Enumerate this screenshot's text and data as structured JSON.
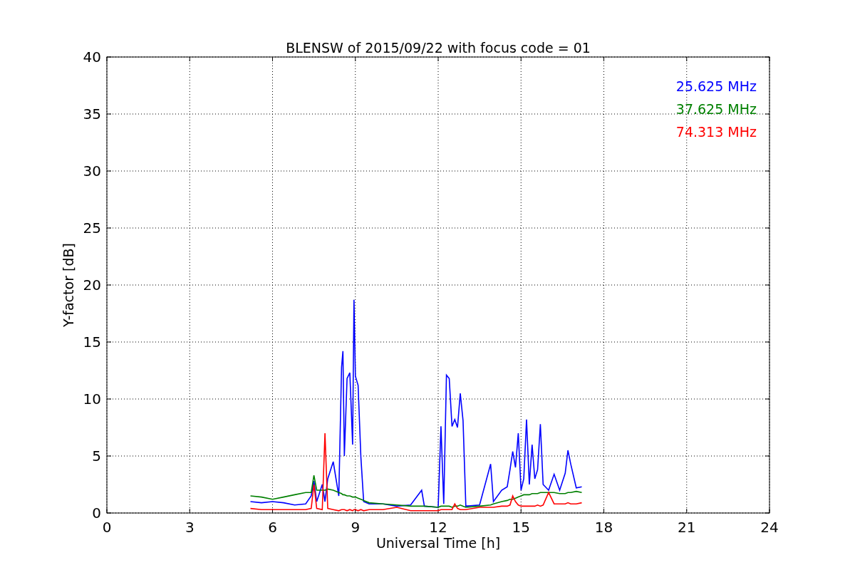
{
  "chart_data": {
    "type": "line",
    "grid": true,
    "title": "BLENSW of 2015/09/22 with focus code = 01",
    "xlabel": "Universal Time [h]",
    "ylabel": "Y-factor [dB]",
    "xlim": [
      0,
      24
    ],
    "ylim": [
      0,
      40
    ],
    "xticks": [
      0,
      3,
      6,
      9,
      12,
      15,
      18,
      21,
      24
    ],
    "yticks": [
      0,
      5,
      10,
      15,
      20,
      25,
      30,
      35,
      40
    ],
    "x": [
      5.2,
      5.6,
      6.0,
      6.4,
      6.8,
      7.2,
      7.4,
      7.5,
      7.6,
      7.8,
      7.9,
      8.0,
      8.2,
      8.4,
      8.5,
      8.55,
      8.6,
      8.7,
      8.8,
      8.9,
      8.95,
      9.0,
      9.1,
      9.2,
      9.3,
      9.5,
      10.0,
      10.5,
      11.0,
      11.4,
      11.5,
      12.0,
      12.1,
      12.2,
      12.3,
      12.4,
      12.5,
      12.6,
      12.7,
      12.8,
      12.9,
      13.0,
      13.5,
      13.9,
      14.0,
      14.3,
      14.5,
      14.6,
      14.7,
      14.8,
      14.9,
      15.0,
      15.1,
      15.2,
      15.3,
      15.4,
      15.5,
      15.6,
      15.7,
      15.8,
      16.0,
      16.2,
      16.4,
      16.6,
      16.7,
      16.8,
      17.0,
      17.2
    ],
    "series": [
      {
        "name": "25.625 MHz",
        "color": "#0000ff",
        "values": [
          1.0,
          0.9,
          1.0,
          0.9,
          0.7,
          0.8,
          1.5,
          2.8,
          1.0,
          2.5,
          1.0,
          3.0,
          4.5,
          1.5,
          12.8,
          14.2,
          5.0,
          11.8,
          12.3,
          6.0,
          18.7,
          12.0,
          11.2,
          4.9,
          1.0,
          0.8,
          0.8,
          0.6,
          0.7,
          2.0,
          0.6,
          0.5,
          7.6,
          0.8,
          12.1,
          11.8,
          7.6,
          8.2,
          7.5,
          10.5,
          8.1,
          0.6,
          0.7,
          4.3,
          1.0,
          2.0,
          2.3,
          3.8,
          5.4,
          4.0,
          7.0,
          2.0,
          3.0,
          8.2,
          2.5,
          6.0,
          3.0,
          3.8,
          7.8,
          2.5,
          2.0,
          3.4,
          2.0,
          3.5,
          5.5,
          4.3,
          2.2,
          2.3
        ]
      },
      {
        "name": "37.625 MHz",
        "color": "#008000",
        "values": [
          1.5,
          1.4,
          1.2,
          1.4,
          1.6,
          1.8,
          1.8,
          3.3,
          2.0,
          2.0,
          2.0,
          2.1,
          2.0,
          1.8,
          1.7,
          1.6,
          1.6,
          1.5,
          1.5,
          1.4,
          1.4,
          1.4,
          1.3,
          1.2,
          1.1,
          0.9,
          0.8,
          0.7,
          0.6,
          0.6,
          0.6,
          0.5,
          0.6,
          0.6,
          0.6,
          0.6,
          0.5,
          0.6,
          0.6,
          0.7,
          0.6,
          0.5,
          0.6,
          0.7,
          0.8,
          1.0,
          1.1,
          1.2,
          1.2,
          1.3,
          1.4,
          1.5,
          1.6,
          1.6,
          1.6,
          1.7,
          1.7,
          1.7,
          1.8,
          1.8,
          1.8,
          1.8,
          1.7,
          1.7,
          1.8,
          1.8,
          1.9,
          1.8
        ]
      },
      {
        "name": "74.313 MHz",
        "color": "#ff0000",
        "values": [
          0.4,
          0.3,
          0.3,
          0.3,
          0.3,
          0.3,
          0.4,
          2.5,
          0.4,
          0.3,
          7.0,
          0.4,
          0.3,
          0.2,
          0.3,
          0.3,
          0.3,
          0.2,
          0.3,
          0.2,
          0.3,
          0.3,
          0.2,
          0.3,
          0.2,
          0.3,
          0.3,
          0.5,
          0.2,
          0.2,
          0.2,
          0.2,
          0.3,
          0.3,
          0.3,
          0.3,
          0.3,
          0.8,
          0.4,
          0.3,
          0.3,
          0.3,
          0.5,
          0.5,
          0.5,
          0.6,
          0.6,
          0.7,
          1.5,
          1.0,
          0.7,
          0.6,
          0.6,
          0.6,
          0.6,
          0.6,
          0.6,
          0.7,
          0.6,
          0.7,
          1.8,
          0.8,
          0.8,
          0.8,
          0.9,
          0.8,
          0.8,
          0.9
        ]
      }
    ]
  }
}
